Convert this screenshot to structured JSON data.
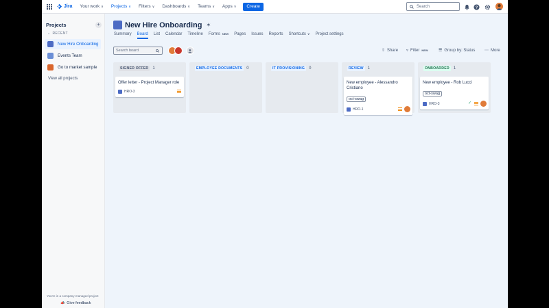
{
  "nav": {
    "app_name": "Jira",
    "items": [
      {
        "label": "Your work",
        "chevron": true
      },
      {
        "label": "Projects",
        "chevron": true,
        "active": true
      },
      {
        "label": "Filters",
        "chevron": true
      },
      {
        "label": "Dashboards",
        "chevron": true
      },
      {
        "label": "Teams",
        "chevron": true
      },
      {
        "label": "Apps",
        "chevron": true
      }
    ],
    "create_label": "Create",
    "search_placeholder": "Search",
    "icons": [
      "notifications-icon",
      "help-icon",
      "settings-icon",
      "profile-avatar"
    ]
  },
  "sidebar": {
    "title": "Projects",
    "recent_label": "RECENT",
    "projects": [
      {
        "name": "New Hire Onboarding",
        "selected": true,
        "color": "#4c6bc4"
      },
      {
        "name": "Events Team",
        "selected": false,
        "color": "#6b8fd6"
      },
      {
        "name": "Go to market sample",
        "selected": false,
        "color": "#d9652b"
      }
    ],
    "view_all": "View all projects",
    "footer_note": "You're in a company-managed project",
    "feedback": "Give feedback"
  },
  "project": {
    "name": "New Hire Onboarding",
    "tabs": [
      {
        "label": "Summary"
      },
      {
        "label": "Board",
        "active": true
      },
      {
        "label": "List"
      },
      {
        "label": "Calendar"
      },
      {
        "label": "Timeline"
      },
      {
        "label": "Forms",
        "badge": "NEW"
      },
      {
        "label": "Pages"
      },
      {
        "label": "Issues"
      },
      {
        "label": "Reports"
      },
      {
        "label": "Shortcuts",
        "chevron": true
      },
      {
        "label": "Project settings"
      }
    ]
  },
  "toolbar": {
    "search_placeholder": "Search board",
    "share": "Share",
    "filter": "Filter",
    "filter_badge": "NEW",
    "group_by": "Group by: Status",
    "more": "More"
  },
  "columns": [
    {
      "name": "SIGNED OFFER",
      "count": "1",
      "label_bg": "#dfe1e6",
      "label_color": "#44546f",
      "cards": [
        {
          "title": "Offer letter - Project Manager role",
          "label": "",
          "key": "HRO-3",
          "priority": "medium",
          "assignee": false,
          "done": false
        }
      ]
    },
    {
      "name": "EMPLOYEE DOCUMENTS",
      "count": "0",
      "label_bg": "#e9f2ff",
      "label_color": "#0c66e4",
      "cards": []
    },
    {
      "name": "IT PROVISIONING",
      "count": "0",
      "label_bg": "#e9f2ff",
      "label_color": "#0c66e4",
      "cards": []
    },
    {
      "name": "REVIEW",
      "count": "1",
      "label_bg": "#e9f2ff",
      "label_color": "#0c66e4",
      "cards": [
        {
          "title": "New employee - Alessandro Cristiano",
          "label": "oct-swag",
          "key": "HRO-1",
          "priority": "medium",
          "assignee": true,
          "done": false
        }
      ]
    },
    {
      "name": "ONBOARDED",
      "count": "1",
      "label_bg": "#dcfff1",
      "label_color": "#216e4e",
      "cards": [
        {
          "title": "New employee - Rob Lucci",
          "label": "oct-swag",
          "key": "HRO-3",
          "priority": "medium",
          "assignee": true,
          "done": true
        }
      ]
    }
  ]
}
